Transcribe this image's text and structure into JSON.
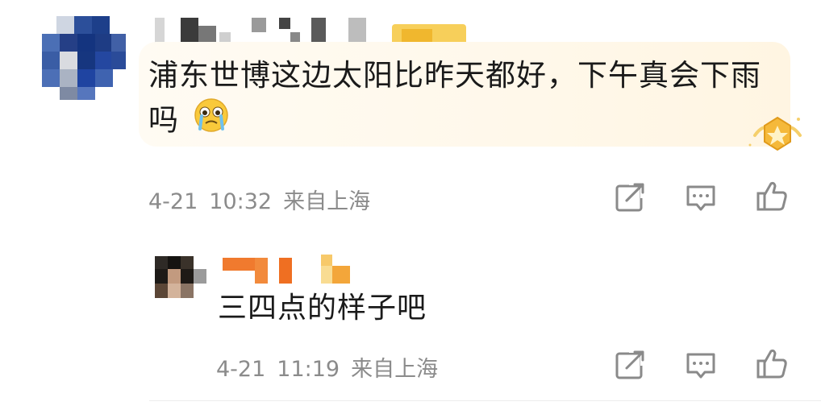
{
  "comments": [
    {
      "text_line1": "浦东世博这边太阳比昨天都好，下午真会下雨",
      "text_line2": "吗",
      "emoji": "crying-face-icon",
      "date": "4-21",
      "time": "10:32",
      "location": "来自上海"
    },
    {
      "text": "三四点的样子吧",
      "date": "4-21",
      "time": "11:19",
      "location": "来自上海"
    }
  ],
  "icons": {
    "share": "share-icon",
    "comment": "comment-icon",
    "like": "like-icon"
  },
  "colors": {
    "bubble": "#fff8ea",
    "meta_text": "#8b8b8b",
    "icon_stroke": "#8a8a8a",
    "badge_gold": "#f5b93a"
  }
}
